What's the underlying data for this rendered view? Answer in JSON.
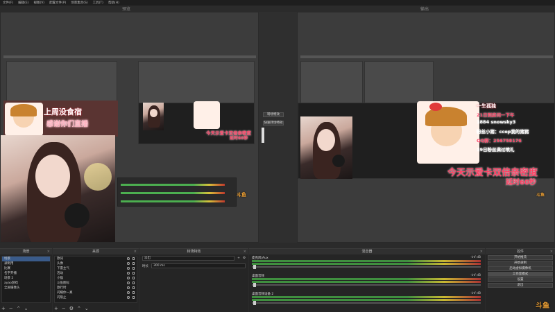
{
  "menu": [
    "文件(F)",
    "编辑(E)",
    "视图(V)",
    "配置文件(P)",
    "场景集合(S)",
    "工具(T)",
    "帮助(H)"
  ],
  "preview_title": "预览",
  "program_title": "输出",
  "transition": {
    "btn1": "转场特效",
    "btn2": "快速转场特效"
  },
  "overlay": {
    "banner_left": "上周没食宿",
    "banner_left2": "感谢你们直播",
    "line_left": "今天示爱卡双倍亲密度",
    "line_left2": "延时60秒",
    "line_right": "今天示爱卡双倍亲密度",
    "line_right2": "延时60秒",
    "side_1": "一生孤独",
    "side_2": "21日到房间一下午",
    "side_3": "1884  snowsky3",
    "side_4": "粉丝小猪：ccop我的猪猪",
    "side_5": "QQ群：256758176",
    "side_6": "19日粉丝满过喷礼"
  },
  "watermark": "斗鱼",
  "docks": {
    "scenes": {
      "title": "场景",
      "items": [
        "场景",
        "录制用",
        "比赛",
        "名字开播",
        "场景 2",
        "ayao游戏",
        "全屏摄像头"
      ]
    },
    "sources": {
      "title": "来源",
      "items": [
        "歌词",
        "头像",
        "下雷主气",
        "活动",
        "小猫",
        "斗鱼图标",
        "歌行时",
        "闪耀你一真",
        "闪限止"
      ]
    },
    "transitions": {
      "title": "转场特效",
      "type_value": "淡出",
      "duration_label": "时长",
      "duration_value": "300 ms"
    },
    "mixer": {
      "title": "混音器",
      "tracks": [
        {
          "name": "麦克风/Aux",
          "db": "-inf dB"
        },
        {
          "name": "桌面音频",
          "db": "-inf dB"
        },
        {
          "name": "桌面音频设备 2",
          "db": "-inf dB"
        }
      ]
    },
    "controls": {
      "title": "控件",
      "buttons": [
        "开始推流",
        "开始录制",
        "启动虚拟摄像机",
        "工作室模式",
        "设置",
        "退出"
      ]
    }
  },
  "colors": {
    "accent": "#3a5b8a",
    "overlay_pink": "#ff5b79",
    "watermark": "#f0a235"
  }
}
